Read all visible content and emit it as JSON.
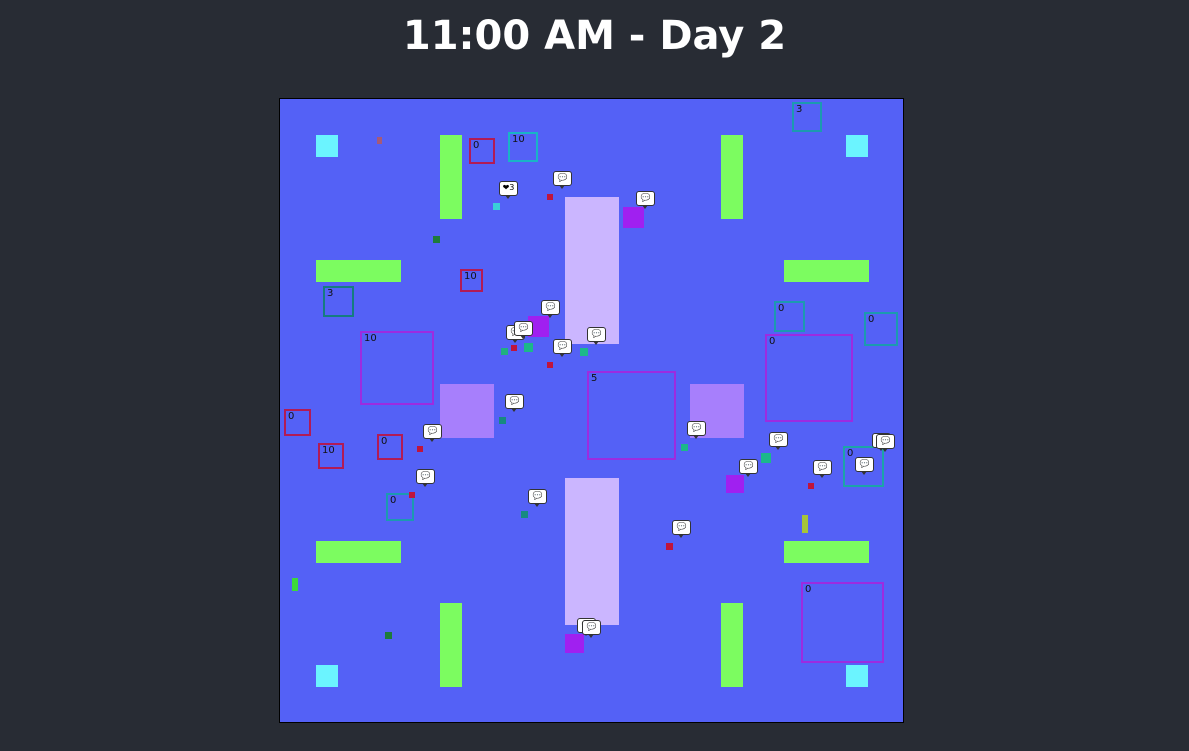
{
  "header": {
    "title": "11:00 AM - Day 2"
  },
  "colors": {
    "page_background": "#282c34",
    "board_background": "#5461f6",
    "table": "#7cfc60",
    "counter": "#cbb6ff",
    "booth": "#a77ffc",
    "corner_tile": "#6bf4ff",
    "zone_red": "#b21b55",
    "zone_teal": "#1c9ab0",
    "zone_purple": "#9c2be0",
    "agent_purple": "#a020f0",
    "speech_bubble": "#ffffff"
  },
  "zones": [
    {
      "label": "3",
      "color": "#1c9ab0"
    },
    {
      "label": "0",
      "color": "#b21b55"
    },
    {
      "label": "10",
      "color": "#19b4c6"
    },
    {
      "label": "10",
      "color": "#b21b55"
    },
    {
      "label": "3",
      "color": "#157c80"
    },
    {
      "label": "0",
      "color": "#1c9ab0"
    },
    {
      "label": "0",
      "color": "#1c9ab0"
    },
    {
      "label": "10",
      "color": "#9c2be0"
    },
    {
      "label": "0",
      "color": "#9c2be0"
    },
    {
      "label": "5",
      "color": "#9c2be0"
    },
    {
      "label": "0",
      "color": "#b21b55"
    },
    {
      "label": "0",
      "color": "#b21b55"
    },
    {
      "label": "10",
      "color": "#b21b55"
    },
    {
      "label": "0",
      "color": "#1ca4a8"
    },
    {
      "label": "0",
      "color": "#1c9ab0"
    },
    {
      "label": "0",
      "color": "#9c2be0"
    }
  ],
  "speech_bubbles": [
    {
      "text": "❤3"
    },
    {
      "text": "💬"
    },
    {
      "text": "💬"
    },
    {
      "text": "💬"
    },
    {
      "text": "💬"
    },
    {
      "text": "💬"
    },
    {
      "text": "💬"
    },
    {
      "text": "💬"
    },
    {
      "text": "💬"
    },
    {
      "text": "💬"
    },
    {
      "text": "💬"
    },
    {
      "text": "💬"
    },
    {
      "text": "💬"
    },
    {
      "text": "💬"
    },
    {
      "text": "💬"
    },
    {
      "text": "💬"
    },
    {
      "text": "💬"
    },
    {
      "text": "💬"
    },
    {
      "text": "💬"
    },
    {
      "text": "💬"
    },
    {
      "text": "💬"
    },
    {
      "text": "💬"
    }
  ]
}
